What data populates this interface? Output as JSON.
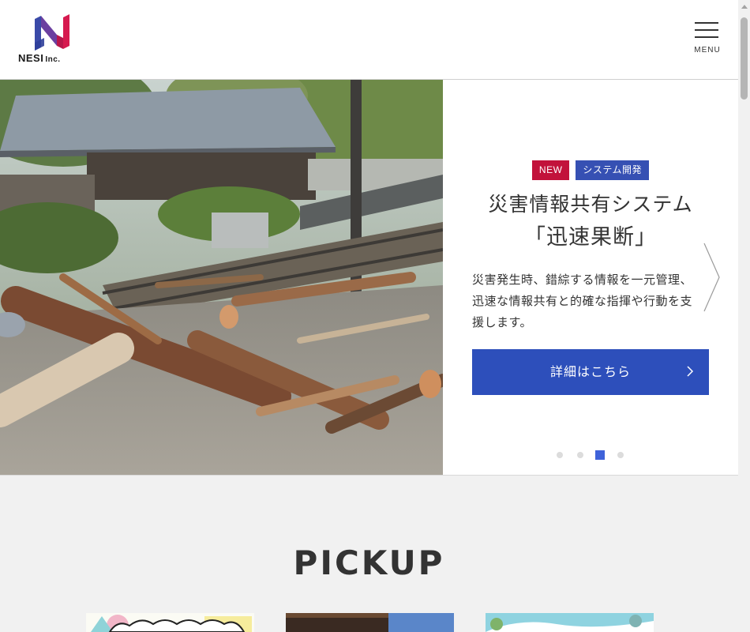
{
  "header": {
    "logo_text": "NESI",
    "logo_suffix": "Inc.",
    "menu_label": "MENU"
  },
  "hero": {
    "tag_new": "NEW",
    "tag_category": "システム開発",
    "title_line1": "災害情報共有システム",
    "title_line2": "「迅速果断」",
    "description": "災害発生時、錯綜する情報を一元管理、迅速な情報共有と的確な指揮や行動を支援します。",
    "button_label": "詳細はこちら",
    "slides_total": 4,
    "active_slide": 3
  },
  "pickup": {
    "title": "PICKUP"
  },
  "colors": {
    "brand_blue": "#2d4fbb",
    "new_red": "#c2123b",
    "category_blue": "#3650b3",
    "dot_active": "#3f62d9"
  },
  "icons": [
    "logo-mark",
    "menu-icon",
    "chevron-right-icon",
    "next-arrow-icon"
  ]
}
